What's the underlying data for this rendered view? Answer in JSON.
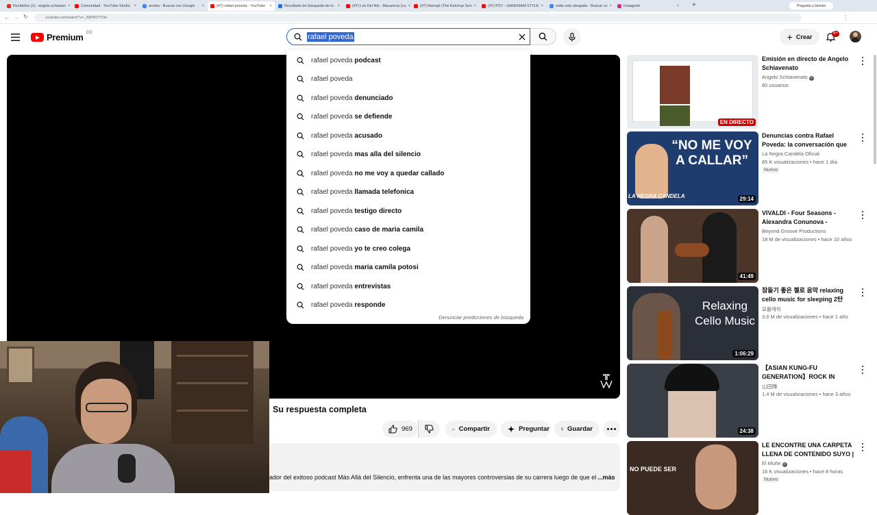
{
  "browser": {
    "tabs": [
      {
        "title": "Recibidos (1) - angelo.schiaven",
        "color": "#d93025"
      },
      {
        "title": "Comunidad - YouTube Studio",
        "color": "#ff0000"
      },
      {
        "title": "arroba - Buscar con Google",
        "color": "#4285f4"
      },
      {
        "title": "(47) rafael poveda - YouTube",
        "color": "#ff0000",
        "active": true
      },
      {
        "title": "Resultado de búsqueda de m",
        "color": "#1a73e8"
      },
      {
        "title": "(47) Los Del Rio - Macarena (La",
        "color": "#ff0000"
      },
      {
        "title": "(47) Aserejé (The Ketchup Son",
        "color": "#ff0000"
      },
      {
        "title": "(47) PSY - GANGNAM STYLE",
        "color": "#ff0000"
      },
      {
        "title": "sofia vela abogada - Buscar co",
        "color": "#4285f4"
      },
      {
        "title": "Instagram",
        "color": "#c13584"
      }
    ],
    "new_tab_label": "+",
    "gemini_label": "Pregunta a Gemini",
    "url": "youtube.com/watch?v=_WjPRt7YOlo"
  },
  "header": {
    "logo_text": "Premium",
    "logo_region": "CO",
    "search_value": "rafael poveda",
    "create_label": "Crear",
    "notif_count": "9+"
  },
  "suggestions": {
    "query_part": "rafael poveda",
    "items": [
      {
        "q": "rafael poveda",
        "c": " podcast"
      },
      {
        "q": "rafael poveda",
        "c": ""
      },
      {
        "q": "rafael poveda",
        "c": " denunciado"
      },
      {
        "q": "rafael poveda",
        "c": " se defiende"
      },
      {
        "q": "rafael poveda",
        "c": " acusado"
      },
      {
        "q": "rafael poveda",
        "c": " mas alla del silencio"
      },
      {
        "q": "rafael poveda",
        "c": " no me voy a quedar callado"
      },
      {
        "q": "rafael poveda",
        "c": " llamada telefonica"
      },
      {
        "q": "rafael poveda",
        "c": " testigo directo"
      },
      {
        "q": "rafael poveda",
        "c": " caso de maria camila"
      },
      {
        "q": "rafael poveda",
        "c": " yo te creo colega"
      },
      {
        "q": "rafael poveda",
        "c": " maria camila potosi"
      },
      {
        "q": "rafael poveda",
        "c": " entrevistas"
      },
      {
        "q": "rafael poveda",
        "c": " responde"
      }
    ],
    "report_label": "Denunciar predicciones de búsqueda"
  },
  "video": {
    "title": "Su respuesta completa",
    "likes": "969",
    "share_label": "Compartir",
    "ask_label": "Preguntar",
    "save_label": "Guardar",
    "description": "ador del exitoso podcast Más Allá del Silencio, enfrenta una de las mayores controversias de su carrera luego de que el co",
    "more_label": "...más"
  },
  "sidebar": [
    {
      "title": "Emisión en directo de Angelo Schiavenato",
      "channel": "Angelo Schiavenato",
      "verified": true,
      "meta": "80 usuarios",
      "live": "EN DIRECTO",
      "thumb": "#e9ecef",
      "thumb_text": ""
    },
    {
      "title": "Denuncias contra Rafael Poveda: la conversación que encendió el ...",
      "channel": "La Negra Candela Oficial",
      "verified": false,
      "meta": "85 K visualizaciones • hace 1 día",
      "badge": "Nuevo",
      "duration": "29:14",
      "thumb": "#1f3c6e",
      "thumb_text": "“NO ME VOY A CALLAR”",
      "thumb_sub": "LA NEGRA CANDELA"
    },
    {
      "title": "VIVALDI - Four Seasons - Alexandra Conunova - Orchestre ...",
      "channel": "Beyond Groove Productions",
      "verified": false,
      "meta": "18 M de visualizaciones • hace 10 años",
      "duration": "41:49",
      "thumb": "#4a3528",
      "thumb_text": ""
    },
    {
      "title": "잠들기 좋은 첼로 음악 relaxing cello music for sleeping 2탄",
      "channel": "요를레히",
      "verified": false,
      "meta": "3,6 M de visualizaciones • hace 1 año",
      "duration": "1:06:29",
      "thumb": "#2b2f38",
      "thumb_text": "Relaxing Cello Music"
    },
    {
      "title": "【ASIAN KUNG-FU GENERATION】ROCK IN JAPAN ...",
      "channel": "山田隊",
      "verified": false,
      "meta": "1,4 M de visualizaciones • hace 3 años",
      "duration": "24:38",
      "thumb": "#3a3f47",
      "thumb_text": ""
    },
    {
      "title": "LE ENCONTRE UNA CARPETA LLENA DE CONTENIDO SUYO | ...",
      "channel": "El Muñe",
      "verified": true,
      "meta": "16 K visualizaciones • hace 8 horas",
      "badge": "Nuevo",
      "thumb": "#3b2a22",
      "thumb_text": "NO PUEDE SER"
    }
  ]
}
